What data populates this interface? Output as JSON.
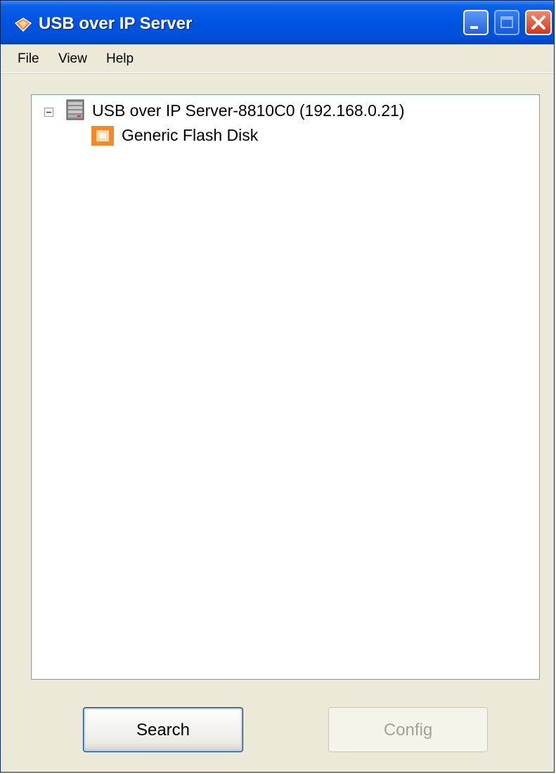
{
  "window": {
    "title": "USB over IP Server"
  },
  "menu": {
    "file": "File",
    "view": "View",
    "help": "Help"
  },
  "tree": {
    "server": {
      "label": "USB over IP Server-8810C0 (192.168.0.21)",
      "expanded": true
    },
    "devices": [
      {
        "label": "Generic  Flash Disk"
      }
    ]
  },
  "buttons": {
    "search": "Search",
    "config": "Config",
    "config_enabled": false
  },
  "colors": {
    "titlebar": "#0054e3",
    "window_bg": "#ece9d8",
    "device_icon": "#f5882b"
  }
}
